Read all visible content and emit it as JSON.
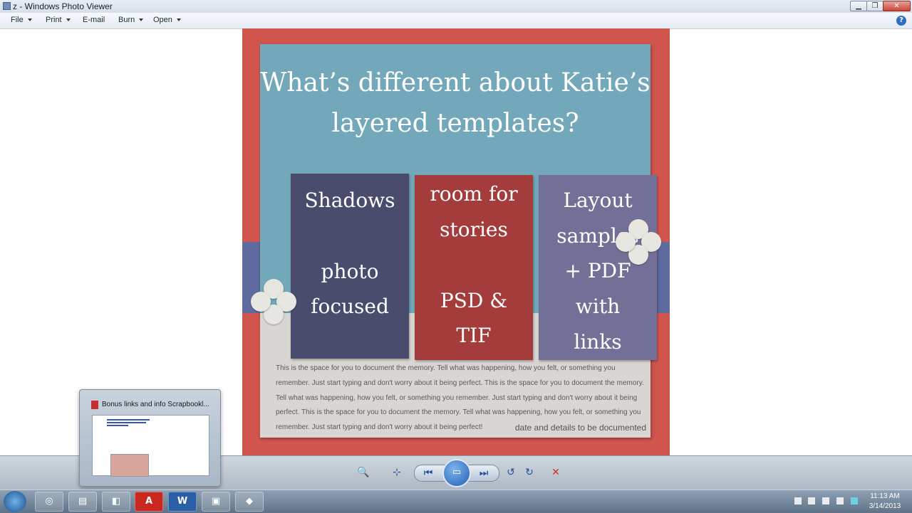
{
  "window": {
    "title": "z - Windows Photo Viewer",
    "buttons": {
      "minimize": "▁",
      "maximize": "❐",
      "close": "✕"
    }
  },
  "menu": {
    "items": [
      {
        "label": "File",
        "has_dropdown": true
      },
      {
        "label": "Print",
        "has_dropdown": true
      },
      {
        "label": "E-mail",
        "has_dropdown": false
      },
      {
        "label": "Burn",
        "has_dropdown": true
      },
      {
        "label": "Open",
        "has_dropdown": true
      }
    ],
    "help": "?"
  },
  "photo": {
    "heading_line1": "What’s different about Katie’s",
    "heading_line2": "layered templates?",
    "cards": [
      {
        "top": "Shadows",
        "bottom_line1": "photo",
        "bottom_line2": "focused",
        "color": "#4a4c6e"
      },
      {
        "top_line1": "room for",
        "top_line2": "stories",
        "bottom_line1": "PSD &",
        "bottom_line2": "TIF",
        "color": "#a53c3c"
      },
      {
        "lines": [
          "Layout",
          "samples",
          "+ PDF",
          "with",
          "links"
        ],
        "color": "#727096"
      }
    ],
    "body_text_lines": [
      "This is the space for you to document the memory. Tell what was happening, how you felt, or something you",
      "remember. Just start typing and don't worry about it being perfect. This is the space for you to document the memory.",
      "Tell what was happening, how you felt, or something you remember. Just start typing and don't worry about it being",
      "perfect. This is the space for you to document the memory. Tell what was happening, how you felt, or something you",
      "remember. Just start typing and don't worry about it being perfect!"
    ],
    "footer": "date and details to be documented",
    "colors": {
      "border": "#d0554d",
      "teal": "#72a8b9",
      "paper": "#d9d5d2"
    }
  },
  "toolbar": {
    "buttons": [
      {
        "name": "zoom-icon",
        "glyph": "🔍"
      },
      {
        "name": "actual-size-icon",
        "glyph": "⊹"
      },
      {
        "name": "previous-icon",
        "glyph": "⏮"
      },
      {
        "name": "slideshow-icon",
        "glyph": "▭"
      },
      {
        "name": "next-icon",
        "glyph": "⏭"
      },
      {
        "name": "rotate-ccw-icon",
        "glyph": "↺"
      },
      {
        "name": "rotate-cw-icon",
        "glyph": "↻"
      },
      {
        "name": "delete-icon",
        "glyph": "✕"
      }
    ]
  },
  "preview": {
    "title": "Bonus links and info Scrapbookl..."
  },
  "taskbar": {
    "apps": [
      {
        "name": "chrome-icon",
        "glyph": "◎"
      },
      {
        "name": "file-explorer-icon",
        "glyph": "▤"
      },
      {
        "name": "app-blue-icon",
        "glyph": "◧"
      },
      {
        "name": "acrobat-icon",
        "glyph": "A"
      },
      {
        "name": "word-icon",
        "glyph": "W"
      },
      {
        "name": "photo-viewer-icon",
        "glyph": "▣"
      },
      {
        "name": "app-dark-icon",
        "glyph": "◆"
      }
    ],
    "clock": {
      "time": "11:13 AM",
      "date": "3/14/2013"
    }
  }
}
